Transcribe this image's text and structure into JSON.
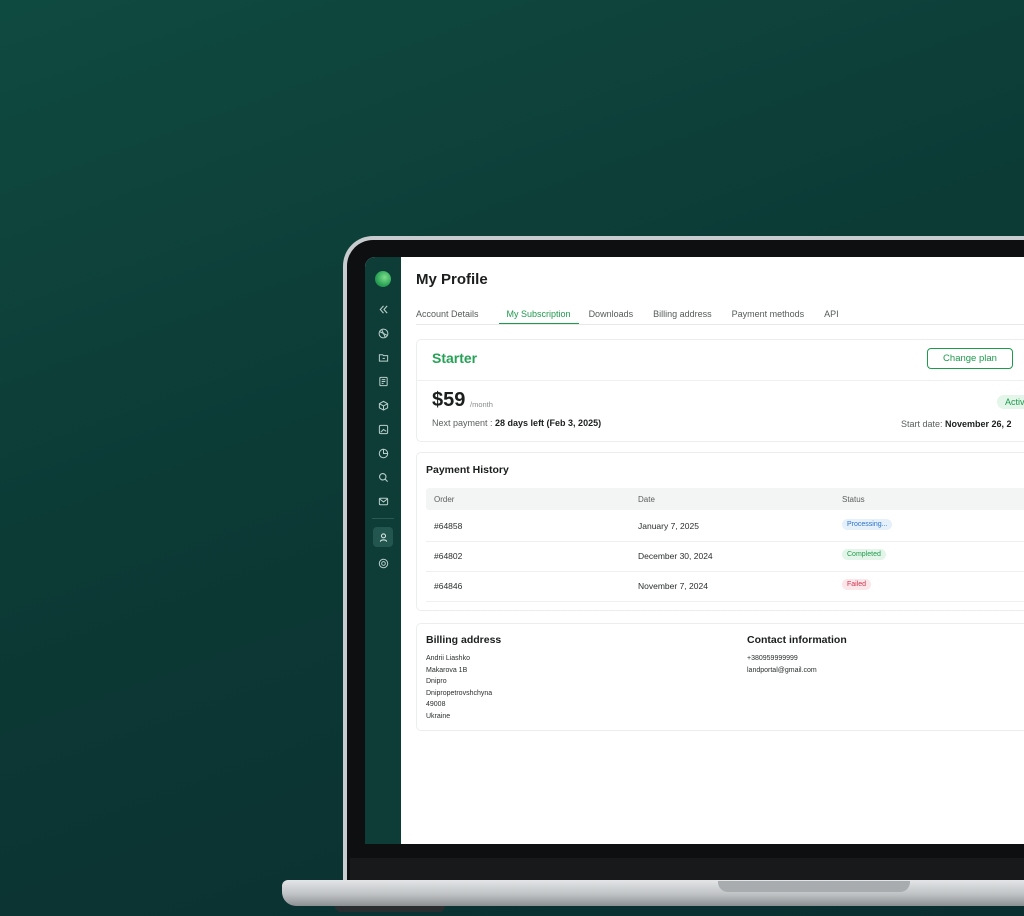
{
  "page": {
    "title": "My Profile"
  },
  "tabs": [
    {
      "label": "Account Details",
      "active": false
    },
    {
      "label": "My Subscription",
      "active": true
    },
    {
      "label": "Downloads",
      "active": false
    },
    {
      "label": "Billing address",
      "active": false
    },
    {
      "label": "Payment methods",
      "active": false
    },
    {
      "label": "API",
      "active": false
    }
  ],
  "plan": {
    "name": "Starter",
    "change_label": "Change plan",
    "price": "$59",
    "period": "/month",
    "next_label": "Next payment : ",
    "next_value": "28 days left (Feb 3, 2025)",
    "status": "Activ",
    "start_label": "Start date: ",
    "start_value": "November 26, 2"
  },
  "history": {
    "title": "Payment History",
    "columns": [
      "Order",
      "Date",
      "Status"
    ],
    "rows": [
      {
        "order": "#64858",
        "date": "January 7, 2025",
        "status": "Processing..."
      },
      {
        "order": "#64802",
        "date": "December 30, 2024",
        "status": "Completed"
      },
      {
        "order": "#64846",
        "date": "November 7, 2024",
        "status": "Failed"
      }
    ]
  },
  "billing": {
    "title": "Billing address",
    "lines": [
      "Andrii Liashko",
      "Makarova 1B",
      "Dnipro",
      "Dnipropetrovshchyna",
      "49008",
      "Ukraine"
    ]
  },
  "contact": {
    "title": "Contact information",
    "lines": [
      "+380959999999",
      "landportal@gmail.com"
    ]
  },
  "sidebar": {
    "icons": [
      "collapse-icon",
      "globe-icon",
      "folder-icon",
      "document-icon",
      "box-icon",
      "image-icon",
      "pie-chart-icon",
      "search-icon",
      "mail-icon",
      "user-icon",
      "settings-icon"
    ]
  },
  "colors": {
    "accent": "#1e9a4d",
    "sidebar": "#0e3d38",
    "background": "#0c3a35"
  }
}
